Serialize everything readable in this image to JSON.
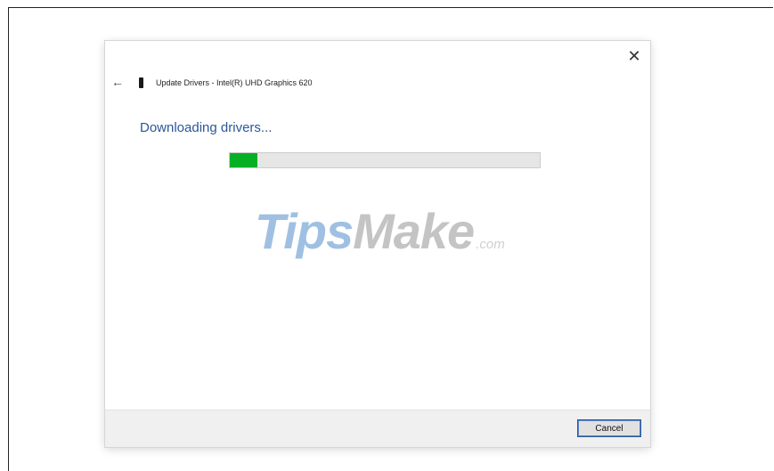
{
  "dialog": {
    "title": "Update Drivers - Intel(R) UHD Graphics 620",
    "heading": "Downloading drivers...",
    "close_glyph": "✕",
    "back_glyph": "←",
    "progress": 0.09,
    "progress_color": "#06b025",
    "cancel_label": "Cancel",
    "icons": {
      "back": "back-arrow-icon",
      "close": "close-icon",
      "device": "display-adapter-icon"
    }
  },
  "watermark": {
    "part1": "Tips",
    "part2": "Make",
    "part3": ".com"
  }
}
